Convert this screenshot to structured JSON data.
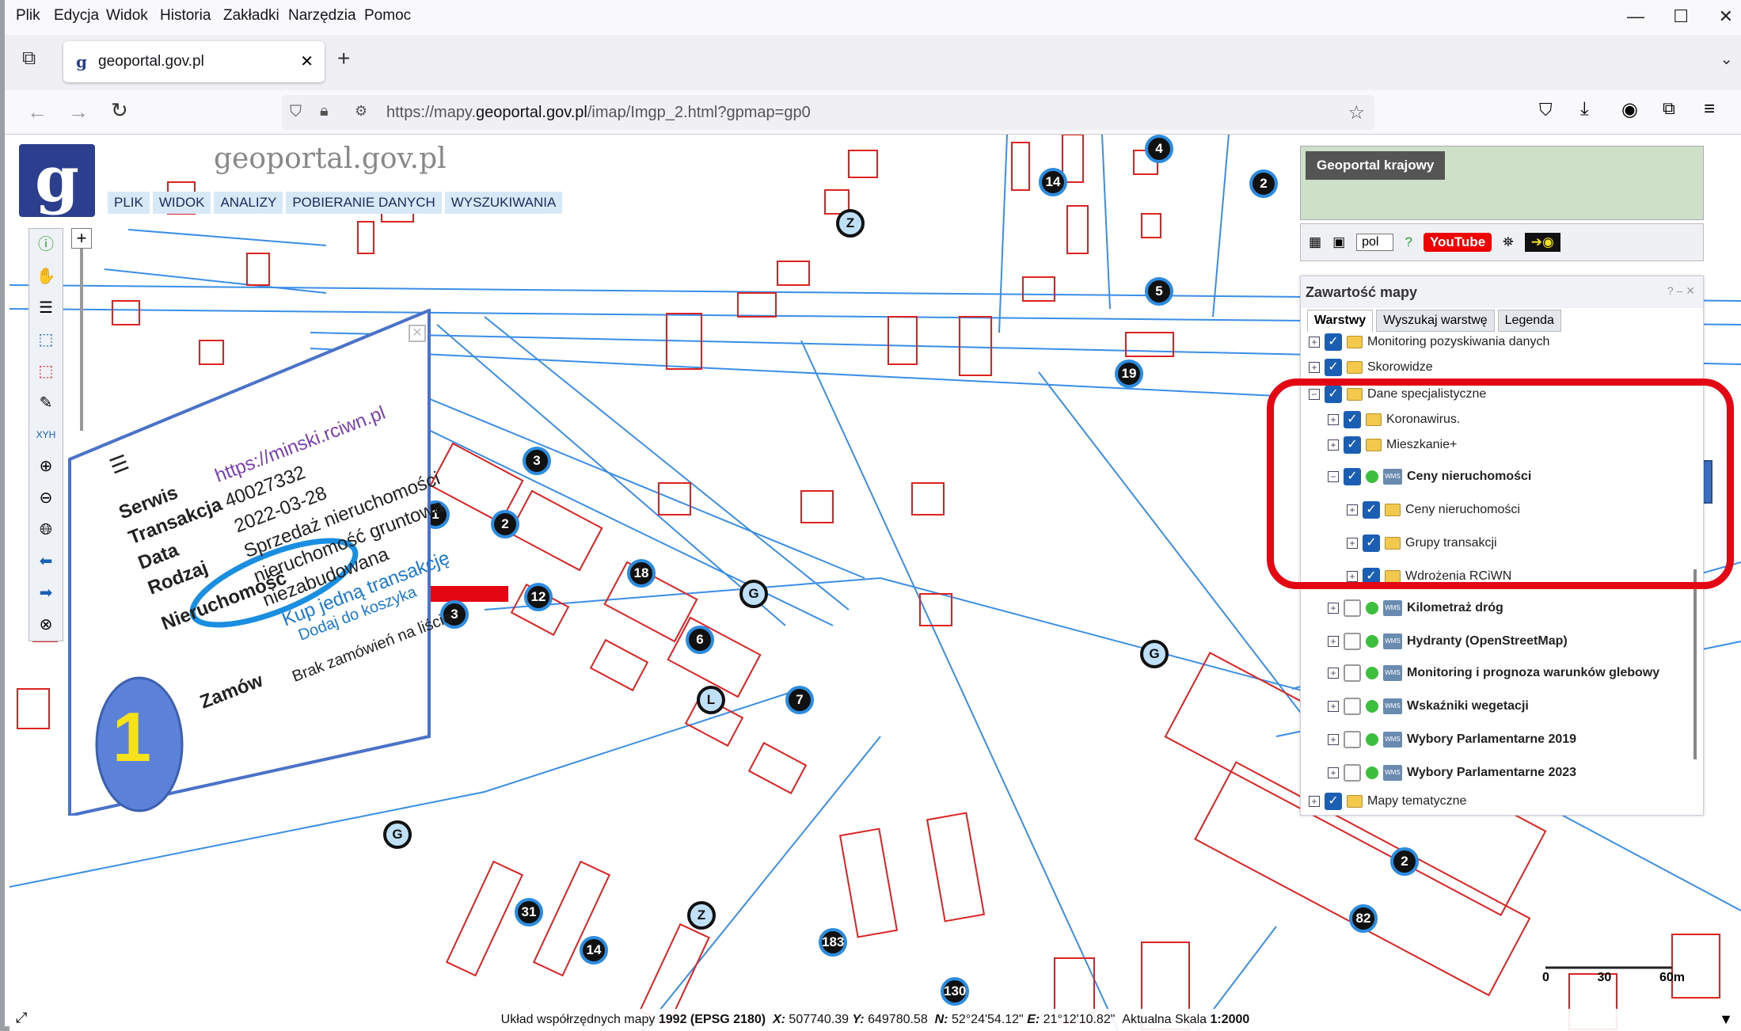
{
  "menubar": {
    "items": [
      "Plik",
      "Edycja",
      "Widok",
      "Historia",
      "Zakładki",
      "Narzędzia",
      "Pomoc"
    ]
  },
  "tab": {
    "title": "geoportal.gov.pl"
  },
  "url": {
    "prefix": "https://mapy.",
    "domain": "geoportal.gov.pl",
    "path": "/imap/Imgp_2.html?gpmap=gp0"
  },
  "brand": "geoportal.gov.pl",
  "gp_menu": [
    "PLIK",
    "WIDOK",
    "ANALIZY",
    "POBIERANIE DANYCH",
    "WYSZUKIWANIA"
  ],
  "banner": {
    "title": "Geoportal krajowy"
  },
  "iconbar": {
    "lang": "pol",
    "youtube": "YouTube"
  },
  "panel": {
    "title": "Zawartość mapy",
    "tabs": [
      "Warstwy",
      "Wyszukaj warstwę",
      "Legenda"
    ],
    "layers": [
      {
        "label": "Monitoring pozyskiwania danych",
        "checked": true
      },
      {
        "label": "Skorowidze",
        "checked": true
      },
      {
        "label": "Dane specjalistyczne",
        "checked": true
      },
      {
        "label": "Koronawirus.",
        "checked": true
      },
      {
        "label": "Mieszkanie+",
        "checked": true
      },
      {
        "label": "Ceny nieruchomości",
        "checked": true,
        "bold": true
      },
      {
        "label": "Ceny nieruchomości",
        "checked": true
      },
      {
        "label": "Grupy transakcji",
        "checked": true
      },
      {
        "label": "Wdrożenia RCiWN",
        "checked": true
      },
      {
        "label": "Kilometraż dróg",
        "checked": false,
        "bold": true
      },
      {
        "label": "Hydranty (OpenStreetMap)",
        "checked": false,
        "bold": true
      },
      {
        "label": "Monitoring i prognoza warunków glebowy",
        "checked": false,
        "bold": true
      },
      {
        "label": "Wskaźniki wegetacji",
        "checked": false,
        "bold": true
      },
      {
        "label": "Wybory Parlamentarne 2019",
        "checked": false,
        "bold": true
      },
      {
        "label": "Wybory Parlamentarne 2023",
        "checked": false,
        "bold": true
      },
      {
        "label": "Mapy tematyczne",
        "checked": true
      }
    ]
  },
  "popup": {
    "labels": [
      "Serwis",
      "Transakcja",
      "Data",
      "Rodzaj",
      "Nieruchomość",
      "Zamów"
    ],
    "values": [
      "https://minski.rciwn.pl",
      "40027332",
      "2022-03-28",
      "Sprzedaż nieruchomości",
      "nieruchomość gruntowa",
      "niezabudowana"
    ],
    "link1": "Kup jedną transakcję",
    "link2": "Dodaj do koszyka",
    "empty": "Brak zamówień na liście",
    "badge": "1"
  },
  "status": {
    "prefix": "Układ współrzędnych mapy",
    "epsg": "1992 (EPSG 2180)",
    "x_label": "X:",
    "x": "507740.39",
    "y_label": "Y:",
    "y": "649780.58",
    "n_label": "N:",
    "n": "52°24'54.12\"",
    "e_label": "E:",
    "e": "21°12'10.82\"",
    "scale_label": "Aktualna Skala",
    "scale": "1:2000"
  },
  "scalebar": {
    "labels": [
      "0",
      "30",
      "60m"
    ]
  },
  "map_markers": [
    "4",
    "14",
    "2",
    "5",
    "19",
    "3",
    "2",
    "18",
    "12",
    "3",
    "6",
    "7",
    "31",
    "14",
    "183",
    "130",
    "82",
    "2",
    "1",
    "Z",
    "Z",
    "G",
    "G",
    "G",
    "L"
  ],
  "colors": {
    "parcel": "#e23",
    "road": "#3a8ee6",
    "highlight": "#e30613",
    "arrow_blue": "#3a6cc0"
  }
}
